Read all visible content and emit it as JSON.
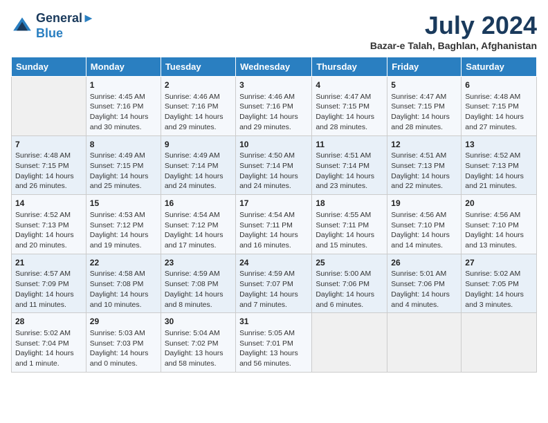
{
  "header": {
    "logo_line1": "General",
    "logo_line2": "Blue",
    "month": "July 2024",
    "location": "Bazar-e Talah, Baghlan, Afghanistan"
  },
  "days_of_week": [
    "Sunday",
    "Monday",
    "Tuesday",
    "Wednesday",
    "Thursday",
    "Friday",
    "Saturday"
  ],
  "weeks": [
    [
      {
        "day": "",
        "info": ""
      },
      {
        "day": "1",
        "info": "Sunrise: 4:45 AM\nSunset: 7:16 PM\nDaylight: 14 hours\nand 30 minutes."
      },
      {
        "day": "2",
        "info": "Sunrise: 4:46 AM\nSunset: 7:16 PM\nDaylight: 14 hours\nand 29 minutes."
      },
      {
        "day": "3",
        "info": "Sunrise: 4:46 AM\nSunset: 7:16 PM\nDaylight: 14 hours\nand 29 minutes."
      },
      {
        "day": "4",
        "info": "Sunrise: 4:47 AM\nSunset: 7:15 PM\nDaylight: 14 hours\nand 28 minutes."
      },
      {
        "day": "5",
        "info": "Sunrise: 4:47 AM\nSunset: 7:15 PM\nDaylight: 14 hours\nand 28 minutes."
      },
      {
        "day": "6",
        "info": "Sunrise: 4:48 AM\nSunset: 7:15 PM\nDaylight: 14 hours\nand 27 minutes."
      }
    ],
    [
      {
        "day": "7",
        "info": "Sunrise: 4:48 AM\nSunset: 7:15 PM\nDaylight: 14 hours\nand 26 minutes."
      },
      {
        "day": "8",
        "info": "Sunrise: 4:49 AM\nSunset: 7:15 PM\nDaylight: 14 hours\nand 25 minutes."
      },
      {
        "day": "9",
        "info": "Sunrise: 4:49 AM\nSunset: 7:14 PM\nDaylight: 14 hours\nand 24 minutes."
      },
      {
        "day": "10",
        "info": "Sunrise: 4:50 AM\nSunset: 7:14 PM\nDaylight: 14 hours\nand 24 minutes."
      },
      {
        "day": "11",
        "info": "Sunrise: 4:51 AM\nSunset: 7:14 PM\nDaylight: 14 hours\nand 23 minutes."
      },
      {
        "day": "12",
        "info": "Sunrise: 4:51 AM\nSunset: 7:13 PM\nDaylight: 14 hours\nand 22 minutes."
      },
      {
        "day": "13",
        "info": "Sunrise: 4:52 AM\nSunset: 7:13 PM\nDaylight: 14 hours\nand 21 minutes."
      }
    ],
    [
      {
        "day": "14",
        "info": "Sunrise: 4:52 AM\nSunset: 7:13 PM\nDaylight: 14 hours\nand 20 minutes."
      },
      {
        "day": "15",
        "info": "Sunrise: 4:53 AM\nSunset: 7:12 PM\nDaylight: 14 hours\nand 19 minutes."
      },
      {
        "day": "16",
        "info": "Sunrise: 4:54 AM\nSunset: 7:12 PM\nDaylight: 14 hours\nand 17 minutes."
      },
      {
        "day": "17",
        "info": "Sunrise: 4:54 AM\nSunset: 7:11 PM\nDaylight: 14 hours\nand 16 minutes."
      },
      {
        "day": "18",
        "info": "Sunrise: 4:55 AM\nSunset: 7:11 PM\nDaylight: 14 hours\nand 15 minutes."
      },
      {
        "day": "19",
        "info": "Sunrise: 4:56 AM\nSunset: 7:10 PM\nDaylight: 14 hours\nand 14 minutes."
      },
      {
        "day": "20",
        "info": "Sunrise: 4:56 AM\nSunset: 7:10 PM\nDaylight: 14 hours\nand 13 minutes."
      }
    ],
    [
      {
        "day": "21",
        "info": "Sunrise: 4:57 AM\nSunset: 7:09 PM\nDaylight: 14 hours\nand 11 minutes."
      },
      {
        "day": "22",
        "info": "Sunrise: 4:58 AM\nSunset: 7:08 PM\nDaylight: 14 hours\nand 10 minutes."
      },
      {
        "day": "23",
        "info": "Sunrise: 4:59 AM\nSunset: 7:08 PM\nDaylight: 14 hours\nand 8 minutes."
      },
      {
        "day": "24",
        "info": "Sunrise: 4:59 AM\nSunset: 7:07 PM\nDaylight: 14 hours\nand 7 minutes."
      },
      {
        "day": "25",
        "info": "Sunrise: 5:00 AM\nSunset: 7:06 PM\nDaylight: 14 hours\nand 6 minutes."
      },
      {
        "day": "26",
        "info": "Sunrise: 5:01 AM\nSunset: 7:06 PM\nDaylight: 14 hours\nand 4 minutes."
      },
      {
        "day": "27",
        "info": "Sunrise: 5:02 AM\nSunset: 7:05 PM\nDaylight: 14 hours\nand 3 minutes."
      }
    ],
    [
      {
        "day": "28",
        "info": "Sunrise: 5:02 AM\nSunset: 7:04 PM\nDaylight: 14 hours\nand 1 minute."
      },
      {
        "day": "29",
        "info": "Sunrise: 5:03 AM\nSunset: 7:03 PM\nDaylight: 14 hours\nand 0 minutes."
      },
      {
        "day": "30",
        "info": "Sunrise: 5:04 AM\nSunset: 7:02 PM\nDaylight: 13 hours\nand 58 minutes."
      },
      {
        "day": "31",
        "info": "Sunrise: 5:05 AM\nSunset: 7:01 PM\nDaylight: 13 hours\nand 56 minutes."
      },
      {
        "day": "",
        "info": ""
      },
      {
        "day": "",
        "info": ""
      },
      {
        "day": "",
        "info": ""
      }
    ]
  ]
}
